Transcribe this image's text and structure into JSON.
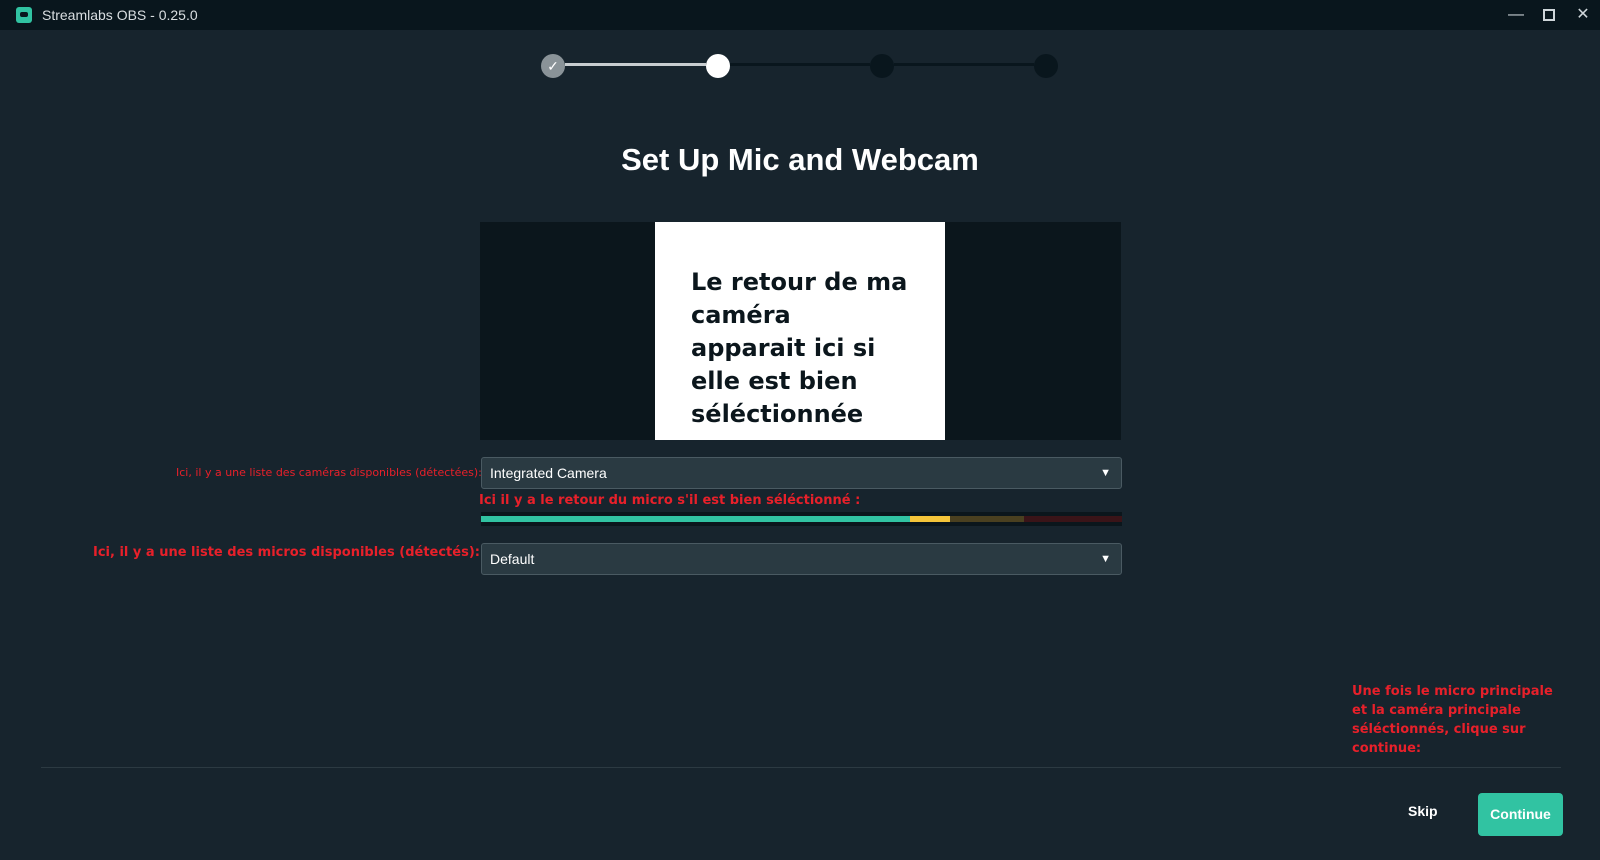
{
  "window": {
    "title": "Streamlabs OBS - 0.25.0",
    "controls": {
      "minimize": "—",
      "close": "✕"
    }
  },
  "stepper": {
    "steps": [
      {
        "state": "completed",
        "glyph": "✓"
      },
      {
        "state": "current"
      },
      {
        "state": "upcoming"
      },
      {
        "state": "upcoming"
      }
    ]
  },
  "main": {
    "heading": "Set Up Mic and Webcam",
    "preview_overlay_text": "Le retour de ma caméra apparait ici si elle est bien séléctionnée",
    "camera_select": {
      "value": "Integrated Camera"
    },
    "mic_level": {
      "filled_fraction": 0.73
    },
    "mic_select": {
      "value": "Default"
    }
  },
  "annotations": {
    "camera_list": "Ici, il y a une liste des caméras disponibles (détectées):",
    "mic_level": "Ici il y a le retour du micro s'il est bien séléctionné :",
    "mic_list": "Ici, il y a une liste des micros disponibles (détectés):",
    "continue_hint": "Une fois le micro principale et la caméra principale séléctionnés, clique sur continue:"
  },
  "footer": {
    "skip_label": "Skip",
    "continue_label": "Continue"
  },
  "colors": {
    "background": "#17242d",
    "titlebar": "#09161d",
    "accent": "#31c3a2",
    "annotation": "#e8202a"
  }
}
